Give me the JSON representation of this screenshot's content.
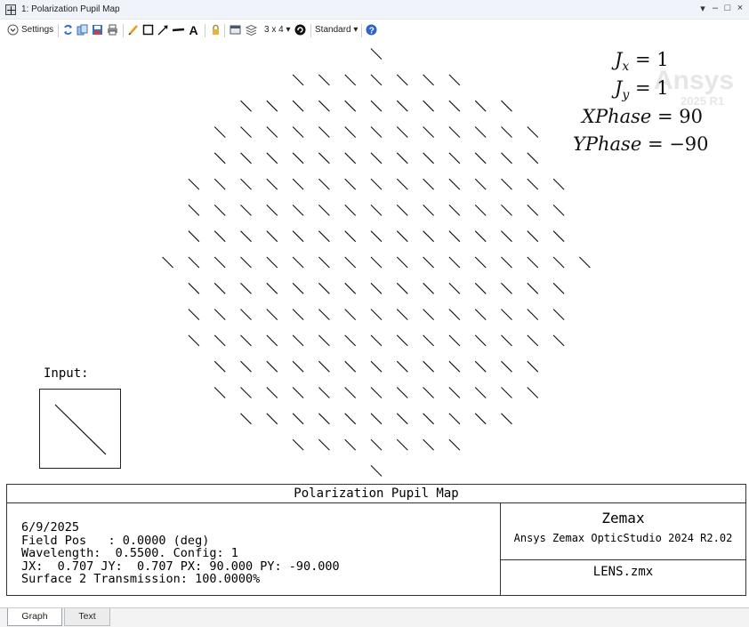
{
  "window": {
    "title": "1: Polarization Pupil Map",
    "controls": [
      "▾",
      "–",
      "□",
      "×"
    ]
  },
  "toolbar": {
    "settings_label": "Settings",
    "layout_label": "3 x 4 ▾",
    "style_label": "Standard ▾",
    "icons": [
      "refresh-icon",
      "copy-icon",
      "save-icon",
      "print-icon",
      "pencil-icon",
      "rectangle-icon",
      "arrow-icon",
      "line-icon",
      "text-icon",
      "lock-icon",
      "window-icon",
      "layers-icon",
      "rotate-icon",
      "help-icon"
    ],
    "accent_color": "#1f5fbf"
  },
  "plot": {
    "equations": {
      "jx": {
        "symbol": "J",
        "sub": "x",
        "rhs": "= 1"
      },
      "jy": {
        "symbol": "J",
        "sub": "y",
        "rhs": "= 1"
      },
      "xphase": {
        "symbol": "XPhase",
        "rhs": "= 90"
      },
      "yphase": {
        "symbol": "YPhase",
        "rhs": "= −90"
      }
    },
    "watermark": {
      "brand": "Ansys",
      "release": "2025 R1"
    },
    "input_label": "Input:",
    "pupil_rows": [
      {
        "row": -8,
        "cols": [
          0
        ]
      },
      {
        "row": -7,
        "cols": [
          -3,
          -2,
          -1,
          0,
          1,
          2,
          3
        ]
      },
      {
        "row": -6,
        "cols": [
          -5,
          -4,
          -3,
          -2,
          -1,
          0,
          1,
          2,
          3,
          4,
          5
        ]
      },
      {
        "row": -5,
        "cols": [
          -6,
          -5,
          -4,
          -3,
          -2,
          -1,
          0,
          1,
          2,
          3,
          4,
          5,
          6
        ]
      },
      {
        "row": -4,
        "cols": [
          -6,
          -5,
          -4,
          -3,
          -2,
          -1,
          0,
          1,
          2,
          3,
          4,
          5,
          6
        ]
      },
      {
        "row": -3,
        "cols": [
          -7,
          -6,
          -5,
          -4,
          -3,
          -2,
          -1,
          0,
          1,
          2,
          3,
          4,
          5,
          6,
          7
        ]
      },
      {
        "row": -2,
        "cols": [
          -7,
          -6,
          -5,
          -4,
          -3,
          -2,
          -1,
          0,
          1,
          2,
          3,
          4,
          5,
          6,
          7
        ]
      },
      {
        "row": -1,
        "cols": [
          -7,
          -6,
          -5,
          -4,
          -3,
          -2,
          -1,
          0,
          1,
          2,
          3,
          4,
          5,
          6,
          7
        ]
      },
      {
        "row": 0,
        "cols": [
          -8,
          -7,
          -6,
          -5,
          -4,
          -3,
          -2,
          -1,
          0,
          1,
          2,
          3,
          4,
          5,
          6,
          7,
          8
        ]
      },
      {
        "row": 1,
        "cols": [
          -7,
          -6,
          -5,
          -4,
          -3,
          -2,
          -1,
          0,
          1,
          2,
          3,
          4,
          5,
          6,
          7
        ]
      },
      {
        "row": 2,
        "cols": [
          -7,
          -6,
          -5,
          -4,
          -3,
          -2,
          -1,
          0,
          1,
          2,
          3,
          4,
          5,
          6,
          7
        ]
      },
      {
        "row": 3,
        "cols": [
          -7,
          -6,
          -5,
          -4,
          -3,
          -2,
          -1,
          0,
          1,
          2,
          3,
          4,
          5,
          6,
          7
        ]
      },
      {
        "row": 4,
        "cols": [
          -6,
          -5,
          -4,
          -3,
          -2,
          -1,
          0,
          1,
          2,
          3,
          4,
          5,
          6
        ]
      },
      {
        "row": 5,
        "cols": [
          -6,
          -5,
          -4,
          -3,
          -2,
          -1,
          0,
          1,
          2,
          3,
          4,
          5,
          6
        ]
      },
      {
        "row": 6,
        "cols": [
          -5,
          -4,
          -3,
          -2,
          -1,
          0,
          1,
          2,
          3,
          4,
          5
        ]
      },
      {
        "row": 7,
        "cols": [
          -3,
          -2,
          -1,
          0,
          1,
          2,
          3
        ]
      },
      {
        "row": 8,
        "cols": [
          0
        ]
      }
    ],
    "ellipse_orientation_deg": -45
  },
  "info": {
    "title": "Polarization Pupil Map",
    "date": "6/9/2025",
    "field_pos": "Field Pos   : 0.0000 (deg)",
    "wavelength": "Wavelength:  0.5500. Config: 1",
    "jones": "JX:  0.707 JY:  0.707 PX: 90.000 PY: -90.000",
    "transmission": "Surface 2 Transmission: 100.0000%",
    "brand": "Zemax",
    "product": "Ansys Zemax OpticStudio 2024 R2.02",
    "file": "LENS.zmx"
  },
  "tabs": [
    {
      "label": "Graph",
      "active": true
    },
    {
      "label": "Text",
      "active": false
    }
  ]
}
